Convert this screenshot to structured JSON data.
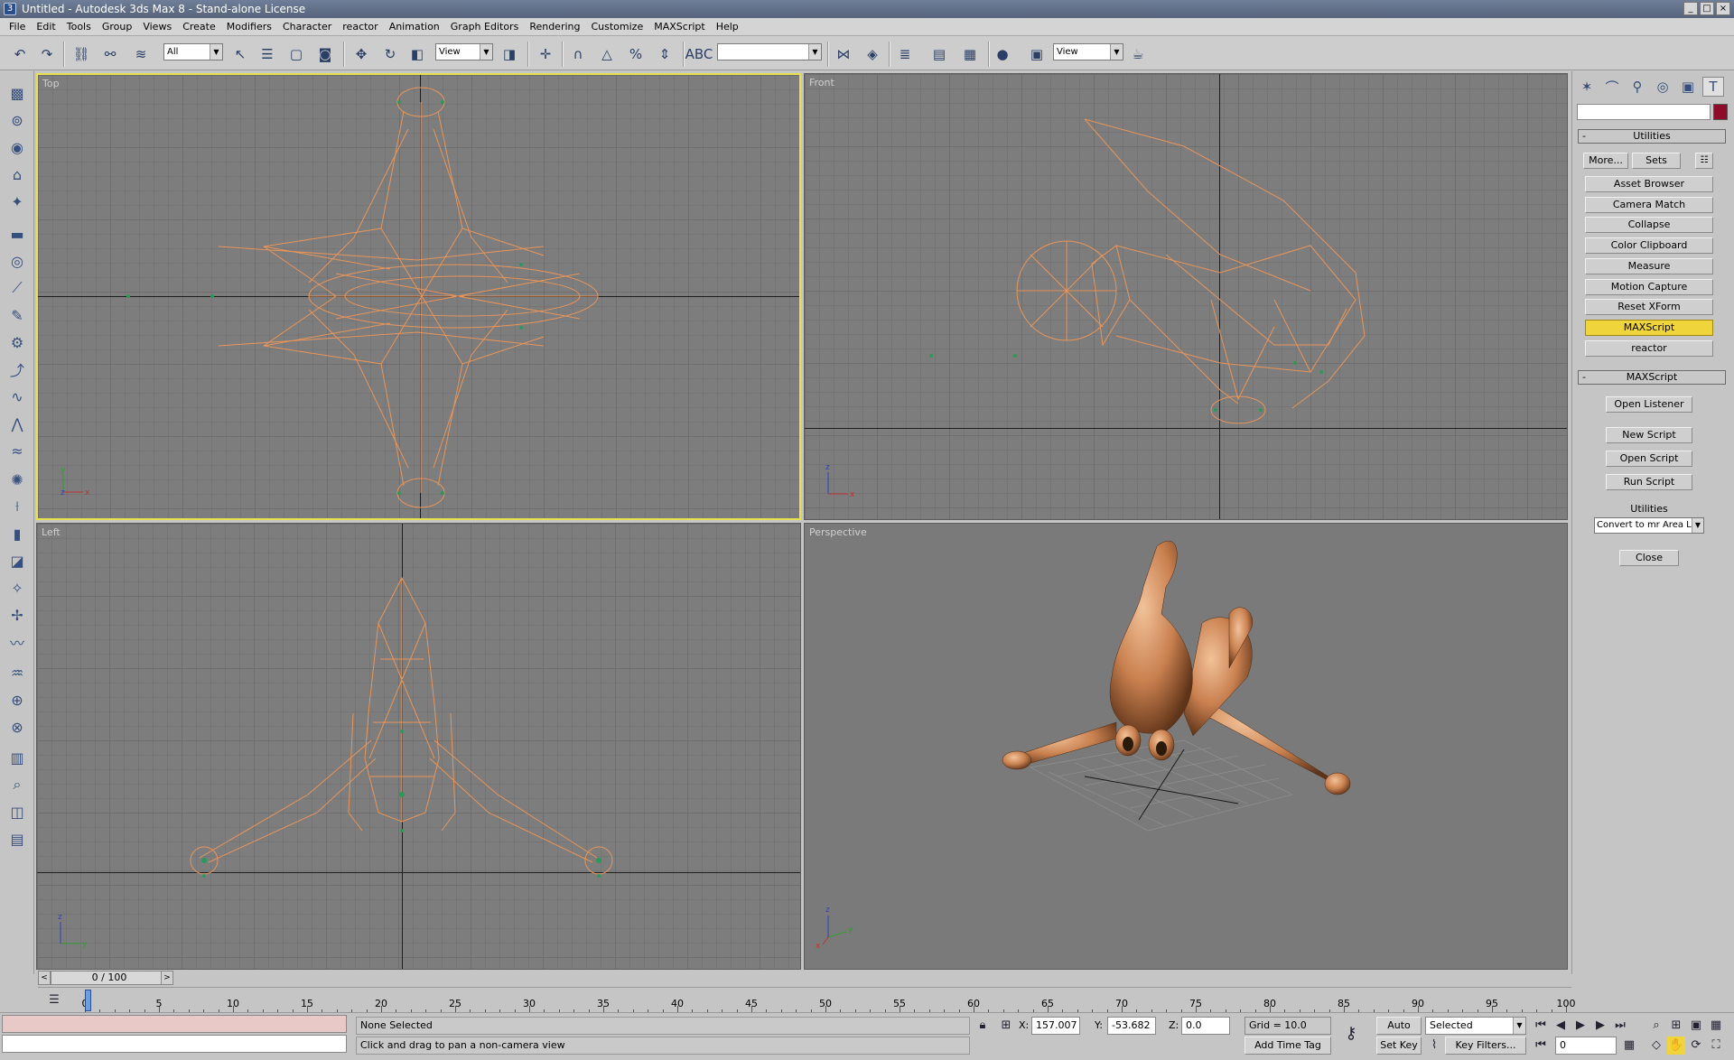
{
  "window": {
    "title": "Untitled - Autodesk 3ds Max 8 - Stand-alone License"
  },
  "menu": [
    "File",
    "Edit",
    "Tools",
    "Group",
    "Views",
    "Create",
    "Modifiers",
    "Character",
    "reactor",
    "Animation",
    "Graph Editors",
    "Rendering",
    "Customize",
    "MAXScript",
    "Help"
  ],
  "toolbar": {
    "selection_filter": "All",
    "ref_coord": "View",
    "named_selection": "",
    "render_view": "View"
  },
  "viewports": {
    "top": {
      "label": "Top"
    },
    "front": {
      "label": "Front"
    },
    "left": {
      "label": "Left"
    },
    "perspective": {
      "label": "Perspective"
    }
  },
  "command_panel": {
    "utilities_title": "Utilities",
    "more": "More...",
    "sets": "Sets",
    "utility_buttons": [
      "Asset Browser",
      "Camera Match",
      "Collapse",
      "Color Clipboard",
      "Measure",
      "Motion Capture",
      "Reset XForm",
      "MAXScript",
      "reactor"
    ],
    "highlighted_utility": "MAXScript",
    "maxscript_title": "MAXScript",
    "open_listener": "Open Listener",
    "new_script": "New Script",
    "open_script": "Open Script",
    "run_script": "Run Script",
    "utilities_label": "Utilities",
    "utilities_select": "Convert to mr Area Lig",
    "close": "Close"
  },
  "timeline": {
    "frame_display": "0 / 100",
    "ticks": [
      "0",
      "5",
      "10",
      "15",
      "20",
      "25",
      "30",
      "35",
      "40",
      "45",
      "50",
      "55",
      "60",
      "65",
      "70",
      "75",
      "80",
      "85",
      "90",
      "95",
      "100"
    ]
  },
  "status": {
    "selection": "None Selected",
    "prompt": "Click and drag to pan a non-camera view",
    "x_label": "X:",
    "x": "157.007",
    "y_label": "Y:",
    "y": "-53.682",
    "z_label": "Z:",
    "z": "0.0",
    "grid": "Grid = 10.0",
    "add_time_tag": "Add Time Tag",
    "auto_key": "Auto Key",
    "set_key": "Set Key",
    "key_mode": "Selected",
    "key_filters": "Key Filters...",
    "current_frame": "0"
  },
  "colors": {
    "wireframe": "#e8955a",
    "active_border": "#e8e050",
    "highlight_button": "#f0d43c",
    "object_color": "#8e0c2a"
  }
}
